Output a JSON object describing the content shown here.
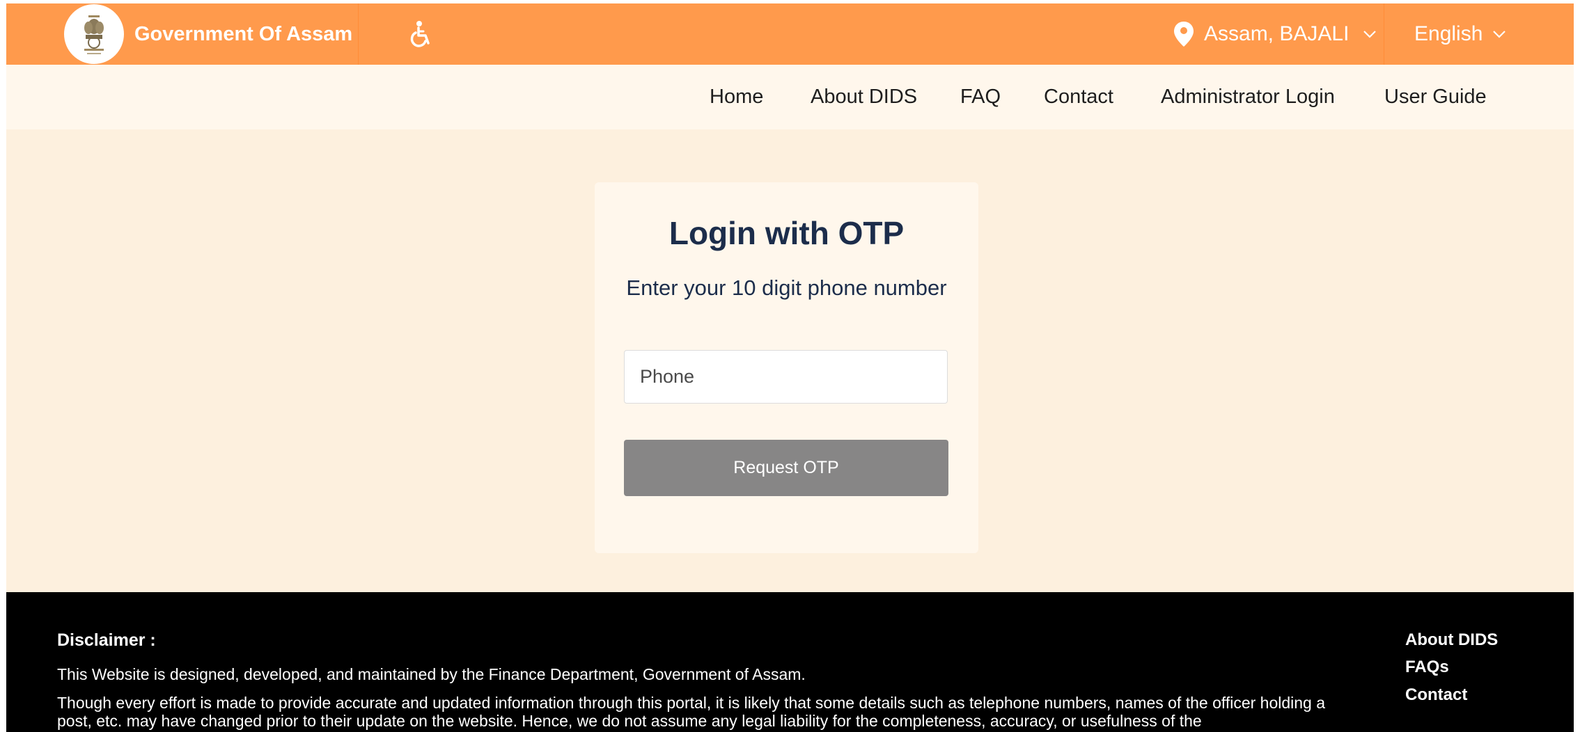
{
  "header": {
    "title": "Government Of Assam",
    "emblem_icon": "state-emblem-icon",
    "accessibility_icon": "accessibility-icon",
    "location_icon": "map-pin-icon",
    "location": "Assam, BAJALI",
    "language": "English",
    "colors": {
      "bar": "#ff9a4c",
      "text": "#ffffff"
    }
  },
  "nav": {
    "items": [
      "Home",
      "About DIDS",
      "FAQ",
      "Contact",
      "Administrator Login",
      "User Guide"
    ]
  },
  "login": {
    "title": "Login with OTP",
    "subtitle": "Enter your 10 digit phone number",
    "phone_placeholder": "Phone",
    "phone_value": "",
    "button_label": "Request OTP",
    "colors": {
      "heading": "#1c2d4b",
      "button": "#878686"
    }
  },
  "footer": {
    "disclaimer_heading": "Disclaimer :",
    "paragraph1": "This Website is designed, developed, and maintained by the Finance Department, Government of Assam.",
    "paragraph2": "Though every effort is made to provide accurate and updated information through this portal, it is likely that some details such as telephone numbers, names of the officer holding a post, etc. may have changed prior to their update on the website. Hence, we do not assume any legal liability for the completeness, accuracy, or usefulness of the",
    "links": [
      "About DIDS",
      "FAQs",
      "Contact"
    ]
  },
  "page_background": "#fdf0de"
}
